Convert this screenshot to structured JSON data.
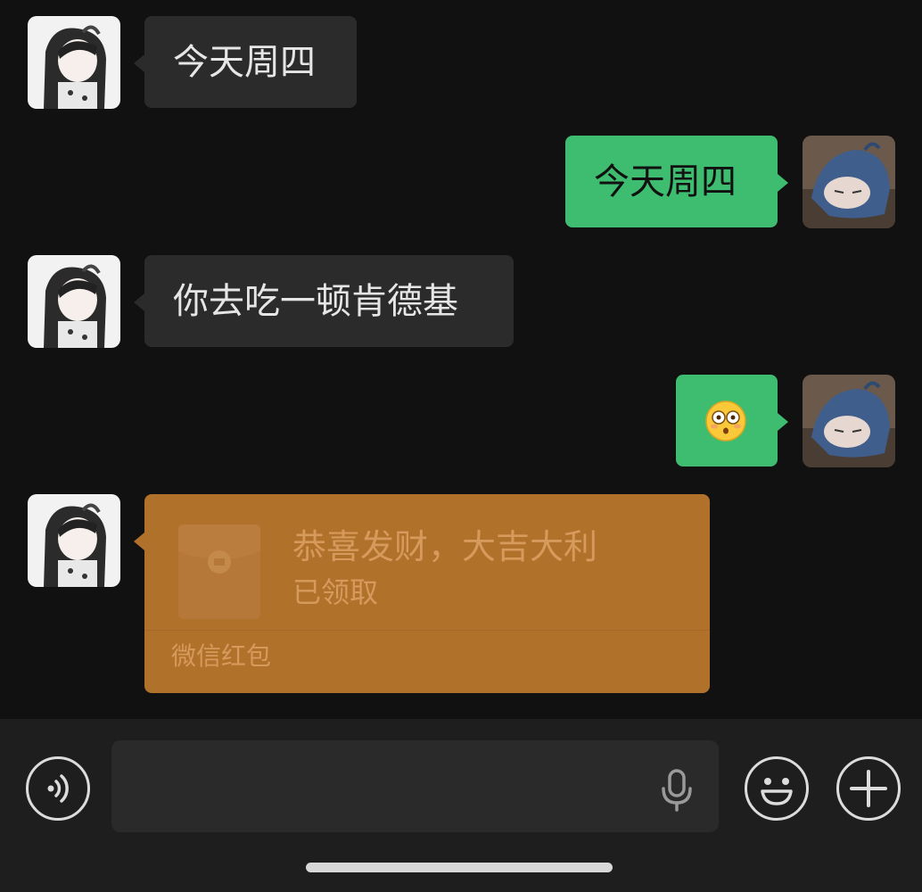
{
  "messages": [
    {
      "side": "in",
      "text": "今天周四"
    },
    {
      "side": "out",
      "text": "今天周四"
    },
    {
      "side": "in",
      "text": "你去吃一顿肯德基"
    },
    {
      "side": "out",
      "emoji": "😳"
    }
  ],
  "red_packet": {
    "title": "恭喜发财，大吉大利",
    "status": "已领取",
    "label": "微信红包"
  },
  "input_bar": {
    "text_value": "",
    "voice_icon": "voice-toggle-icon",
    "mic_icon": "microphone-icon",
    "emoji_icon": "emoji-icon",
    "more_icon": "plus-icon"
  },
  "colors": {
    "background": "#111111",
    "incoming_bubble": "#2b2b2b",
    "outgoing_bubble": "#3ebd70",
    "red_packet": "#b0712b",
    "input_bar": "#1e1e1e"
  }
}
